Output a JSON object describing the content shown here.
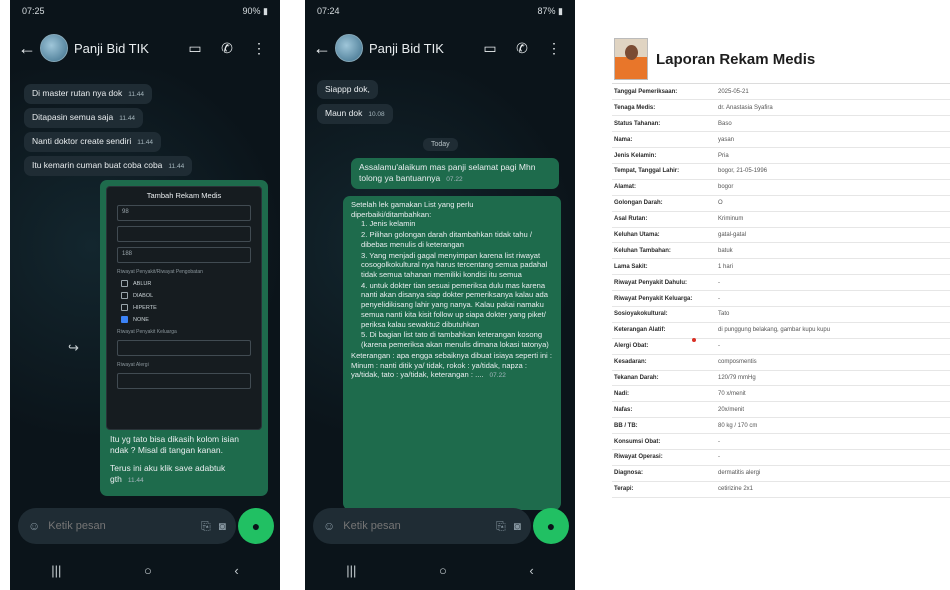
{
  "phone1": {
    "status": {
      "time": "07:25",
      "right": "90% ▮"
    },
    "header": {
      "title": "Panji Bid TIK"
    },
    "messages": [
      {
        "text": "Di master rutan nya dok",
        "time": "11.44"
      },
      {
        "text": "Ditapasin semua saja",
        "time": "11.44"
      },
      {
        "text": "Nanti doktor create sendiri",
        "time": "11.44"
      },
      {
        "text": "Itu kemarin cuman buat coba coba",
        "time": "11.44"
      }
    ],
    "screenshot": {
      "title": "Tambah Rekam Medis",
      "fields": [
        "98",
        "",
        "188"
      ],
      "section_label": "Riwayat Penyakit/Riwayat Pengobatan",
      "checks": [
        "ABLUR",
        "DIABOL",
        "HIPERTE",
        "NONE"
      ],
      "more_labels": [
        "Riwayat Penyakit Keluarga",
        "Riwayat Alergi"
      ]
    },
    "reply": {
      "text": "Itu yg tato bisa dikasih kolom isian ndak ? Misal di tangan kanan.",
      "time": ""
    },
    "reply2": {
      "text": "Terus ini aku klik save adabtuk gth",
      "time": "11.44"
    },
    "input": {
      "placeholder": "Ketik pesan"
    }
  },
  "phone2": {
    "status": {
      "time": "07:24",
      "right": "87% ▮"
    },
    "header": {
      "title": "Panji Bid TIK"
    },
    "in_messages": [
      {
        "text": "Siappp dok,",
        "time": ""
      },
      {
        "text": "Maun dok",
        "time": "10.08"
      }
    ],
    "date_pill": "Today",
    "greeting": {
      "text": "Assalamu'alaikum mas panji selamat pagi Mhn tolong ya bantuannya",
      "time": "07.22"
    },
    "list_intro": "Setelah lek gamakan List yang perlu diperbaiki/ditambahkan:",
    "list": [
      "1. Jenis kelamin",
      "2. Pilihan golongan darah ditambahkan tidak tahu / dibebas menulis di keterangan",
      "3. Yang menjadi gagal menyimpan karena list riwayat cosogolkokultural nya harus tercentang semua padahal tidak semua tahanan memiliki kondisi itu semua",
      "4. untuk dokter tian sesuai pemeriksa dulu mas karena nanti akan disanya siap dokter pemeriksanya kalau ada penyelidikisang lahir yang nanya. Kalau pakai namaku semua nanti kita kisit follow up siapa dokter yang piket/ periksa kalau sewaktu2 dibutuhkan",
      "5. Di bagian list tato di tambahkan keterangan kosong (karena pemeriksa akan menulis dimana lokasi tatonya)"
    ],
    "list_outro": "Keterangan : apa engga sebaiknya dibuat isiaya seperti ini : Minum : nanti ditik ya/ tidak, rokok : ya/tidak, napza : ya/tidak, tato : ya/tidak, keterangan : ....",
    "list_time": "07.22",
    "input": {
      "placeholder": "Ketik pesan"
    }
  },
  "doc": {
    "title": "Laporan Rekam Medis",
    "rows": [
      {
        "k": "Tanggal Pemeriksaan:",
        "v": "2025-05-21"
      },
      {
        "k": "Tenaga Medis:",
        "v": "dr. Anastasia Syafira"
      },
      {
        "k": "Status Tahanan:",
        "v": "Baso"
      },
      {
        "k": "Nama:",
        "v": "yasan"
      },
      {
        "k": "Jenis Kelamin:",
        "v": "Pria"
      },
      {
        "k": "Tempat, Tanggal Lahir:",
        "v": "bogor, 21-05-1996"
      },
      {
        "k": "Alamat:",
        "v": "bogor"
      },
      {
        "k": "Golongan Darah:",
        "v": "O"
      },
      {
        "k": "Asal Rutan:",
        "v": "Kriminum"
      },
      {
        "k": "Keluhan Utama:",
        "v": "gatal-gatal"
      },
      {
        "k": "Keluhan Tambahan:",
        "v": "batuk"
      },
      {
        "k": "Lama Sakit:",
        "v": "1 hari"
      },
      {
        "k": "Riwayat Penyakit Dahulu:",
        "v": "-"
      },
      {
        "k": "Riwayat Penyakit Keluarga:",
        "v": "-"
      },
      {
        "k": "Sosioyakokultural:",
        "v": "Tato"
      },
      {
        "k": "Keterangan Alatif:",
        "v": "di punggung belakang, gambar kupu kupu"
      },
      {
        "k": "Alergi Obat:",
        "v": "-"
      },
      {
        "k": "Kesadaran:",
        "v": "composmentis"
      },
      {
        "k": "Tekanan Darah:",
        "v": "120/79 mmHg"
      },
      {
        "k": "Nadi:",
        "v": "70 x/menit"
      },
      {
        "k": "Nafas:",
        "v": "20x/menit"
      },
      {
        "k": "BB / TB:",
        "v": "80 kg / 170 cm"
      },
      {
        "k": "Konsumsi Obat:",
        "v": "-"
      },
      {
        "k": "Riwayat Operasi:",
        "v": "-"
      },
      {
        "k": "Diagnosa:",
        "v": "dermatitis alergi"
      },
      {
        "k": "Terapi:",
        "v": "cetirizine 2x1"
      }
    ]
  }
}
